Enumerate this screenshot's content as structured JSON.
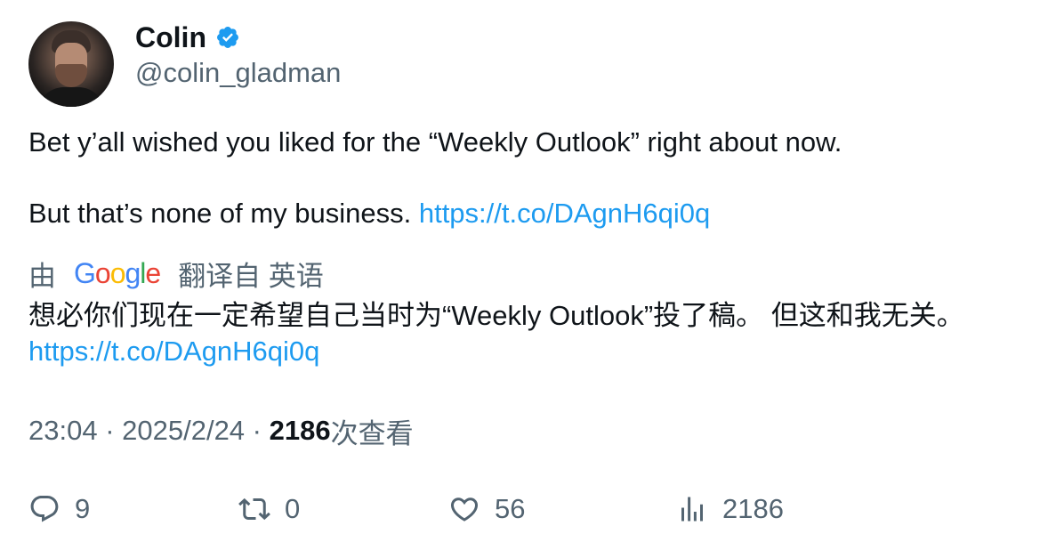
{
  "author": {
    "name": "Colin",
    "handle": "@colin_gladman",
    "verified_icon": "verified-badge-icon"
  },
  "tweet": {
    "line1": "Bet y’all wished you liked for the “Weekly Outlook” right about now.",
    "line2_text": "But that’s none of my business. ",
    "line2_link": "https://t.co/DAgnH6qi0q"
  },
  "translation": {
    "prefix": "由",
    "google_letters": [
      "G",
      "o",
      "o",
      "g",
      "l",
      "e"
    ],
    "suffix": "翻译自 英语",
    "text": "想必你们现在一定希望自己当时为“Weekly Outlook”投了稿。 但这和我无关。",
    "link": "https://t.co/DAgnH6qi0q"
  },
  "meta": {
    "time": "23:04",
    "sep1": " · ",
    "date": "2025/2/24",
    "sep2": " · ",
    "views_count": "2186",
    "views_label": "次查看"
  },
  "actions": {
    "replies": "9",
    "retweets": "0",
    "likes": "56",
    "views": "2186"
  },
  "colors": {
    "link": "#1d9bf0",
    "secondary_text": "#536471",
    "primary_text": "#0f1419"
  }
}
